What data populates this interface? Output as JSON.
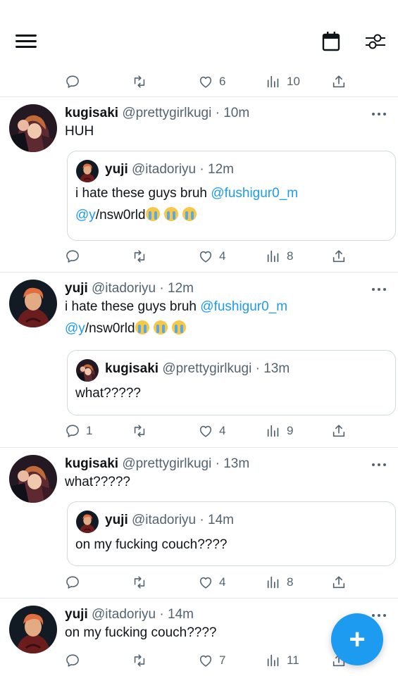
{
  "top_actions": {
    "reply": "",
    "retweet": "",
    "likes": "6",
    "views": "10"
  },
  "posts": [
    {
      "name": "kugisaki",
      "handle": "@prettygirlkugi",
      "dot": "·",
      "time": "10m",
      "text": "HUH",
      "quote": {
        "name": "yuji",
        "handle": "@itadoriyu",
        "dot": "·",
        "time": "12m",
        "text_prefix": "i hate these guys bruh ",
        "mention1": "@fushigur0_m",
        "mention2": "@y",
        "text_suffix": "/nsw0rld"
      },
      "actions": {
        "reply": "",
        "retweet": "",
        "likes": "4",
        "views": "8"
      }
    },
    {
      "name": "yuji",
      "handle": "@itadoriyu",
      "dot": "·",
      "time": "12m",
      "text_prefix": "i hate these guys bruh ",
      "mention1": "@fushigur0_m",
      "mention2": "@y",
      "text_suffix": "/nsw0rld",
      "quote": {
        "name": "kugisaki",
        "handle": "@prettygirlkugi",
        "dot": "·",
        "time": "13m",
        "text": "what?????"
      },
      "actions": {
        "reply": "1",
        "retweet": "",
        "likes": "4",
        "views": "9"
      }
    },
    {
      "name": "kugisaki",
      "handle": "@prettygirlkugi",
      "dot": "·",
      "time": "13m",
      "text": "what?????",
      "quote": {
        "name": "yuji",
        "handle": "@itadoriyu",
        "dot": "·",
        "time": "14m",
        "text": "on my fucking couch????"
      },
      "actions": {
        "reply": "",
        "retweet": "",
        "likes": "4",
        "views": "8"
      }
    },
    {
      "name": "yuji",
      "handle": "@itadoriyu",
      "dot": "·",
      "time": "14m",
      "text": "on my fucking couch????",
      "actions": {
        "reply": "",
        "retweet": "",
        "likes": "7",
        "views": "11"
      }
    }
  ],
  "fab_label": "+",
  "colors": {
    "accent": "#1d9bf0",
    "muted": "#536471",
    "text": "#0f1419",
    "divider": "#e1e6ea"
  },
  "icons": [
    "menu-icon",
    "calendar-icon",
    "filter-icon",
    "reply-icon",
    "retweet-icon",
    "like-icon",
    "views-icon",
    "share-icon",
    "more-icon",
    "crying-emoji"
  ]
}
